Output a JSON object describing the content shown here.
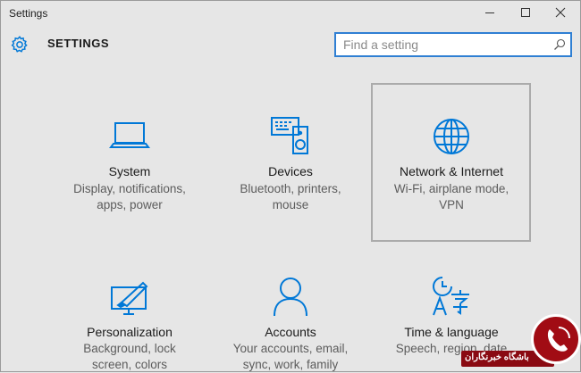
{
  "window": {
    "title": "Settings"
  },
  "header": {
    "heading": "SETTINGS"
  },
  "search": {
    "placeholder": "Find a setting"
  },
  "accent_color": "#0078d7",
  "tiles": [
    {
      "name": "System",
      "desc1": "Display, notifications,",
      "desc2": "apps, power",
      "icon": "laptop-icon"
    },
    {
      "name": "Devices",
      "desc1": "Bluetooth, printers,",
      "desc2": "mouse",
      "icon": "devices-icon"
    },
    {
      "name": "Network & Internet",
      "desc1": "Wi-Fi, airplane mode,",
      "desc2": "VPN",
      "icon": "globe-icon"
    },
    {
      "name": "Personalization",
      "desc1": "Background, lock",
      "desc2": "screen, colors",
      "icon": "personalization-icon"
    },
    {
      "name": "Accounts",
      "desc1": "Your accounts, email,",
      "desc2": "sync, work, family",
      "icon": "person-icon"
    },
    {
      "name": "Time & language",
      "desc1": "Speech, region, date",
      "desc2": "",
      "icon": "time-language-icon"
    }
  ],
  "watermark": {
    "text": "باشگاه خبرنگاران"
  }
}
